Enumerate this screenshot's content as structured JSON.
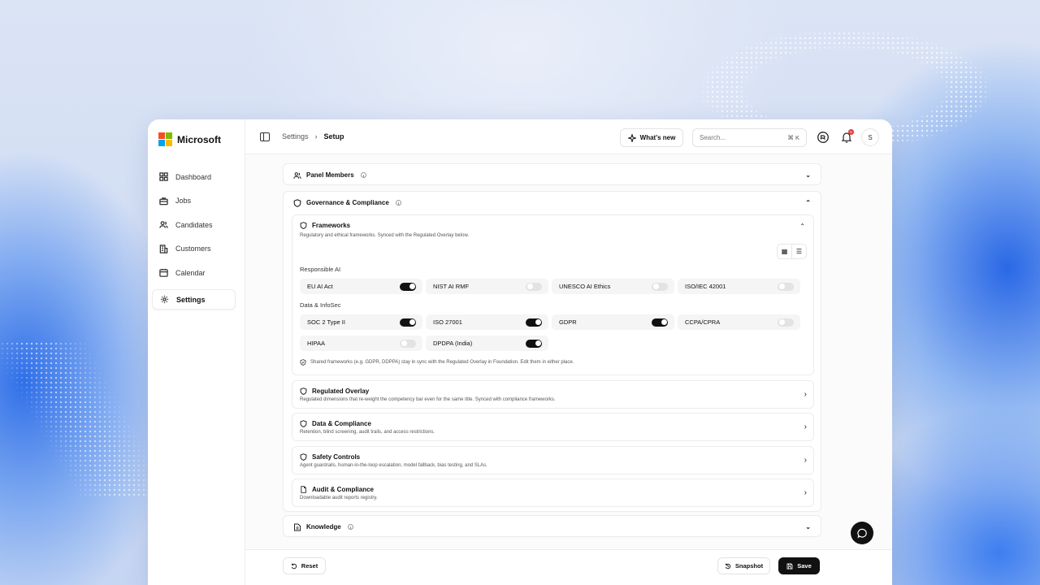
{
  "brand": {
    "name": "Microsoft",
    "colors": [
      "#f25022",
      "#7fba00",
      "#00a4ef",
      "#ffb900"
    ]
  },
  "sidebar": {
    "items": [
      {
        "label": "Dashboard",
        "icon": "grid-icon"
      },
      {
        "label": "Jobs",
        "icon": "briefcase-icon"
      },
      {
        "label": "Candidates",
        "icon": "users-icon"
      },
      {
        "label": "Customers",
        "icon": "building-icon"
      },
      {
        "label": "Calendar",
        "icon": "calendar-icon"
      },
      {
        "label": "Settings",
        "icon": "gear-icon",
        "active": true
      }
    ]
  },
  "header": {
    "breadcrumb": [
      "Settings",
      "Setup"
    ],
    "whats_new": "What's new",
    "search_placeholder": "Search...",
    "search_shortcut": "⌘ K",
    "notification_count": "6",
    "avatar_initial": "S"
  },
  "sections": {
    "panel_members": "Panel Members",
    "governance": "Governance & Compliance",
    "knowledge": "Knowledge"
  },
  "frameworks": {
    "title": "Frameworks",
    "description": "Regulatory and ethical frameworks. Synced with the Regulated Overlay below.",
    "groups": [
      {
        "label": "Responsible AI",
        "items": [
          {
            "name": "EU AI Act",
            "on": true
          },
          {
            "name": "NIST AI RMF",
            "on": false
          },
          {
            "name": "UNESCO AI Ethics",
            "on": false
          },
          {
            "name": "ISO/IEC 42001",
            "on": false
          }
        ]
      },
      {
        "label": "Data & InfoSec",
        "items": [
          {
            "name": "SOC 2 Type II",
            "on": true
          },
          {
            "name": "ISO 27001",
            "on": true
          },
          {
            "name": "GDPR",
            "on": true
          },
          {
            "name": "CCPA/CPRA",
            "on": false
          },
          {
            "name": "HIPAA",
            "on": false
          },
          {
            "name": "DPDPA (India)",
            "on": true
          }
        ]
      }
    ],
    "note": "Shared frameworks (e.g. GDPR, DDPPA) stay in sync with the Regulated Overlay in Foundation. Edit them in either place."
  },
  "subsections": [
    {
      "title": "Regulated Overlay",
      "description": "Regulated dimensions that re-weight the competency bar even for the same title. Synced with compliance frameworks."
    },
    {
      "title": "Data & Compliance",
      "description": "Retention, blind screening, audit trails, and access restrictions."
    },
    {
      "title": "Safety Controls",
      "description": "Agent guardrails, human-in-the-loop escalation, model fallback, bias testing, and SLAs."
    },
    {
      "title": "Audit & Compliance",
      "description": "Downloadable audit reports registry."
    }
  ],
  "footer": {
    "reset": "Reset",
    "snapshot": "Snapshot",
    "save": "Save"
  }
}
